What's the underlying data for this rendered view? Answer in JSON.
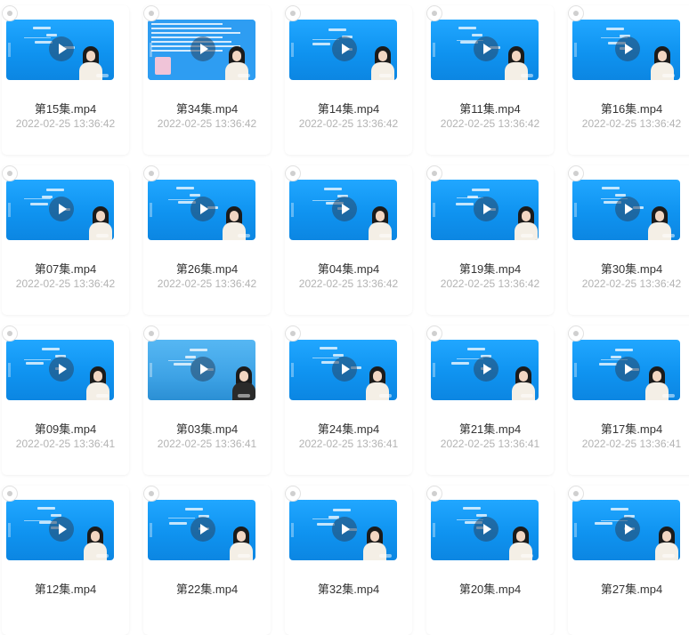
{
  "videos": [
    {
      "name": "第15集.mp4",
      "time": "2022-02-25 13:36:42",
      "variant": "normal"
    },
    {
      "name": "第34集.mp4",
      "time": "2022-02-25 13:36:42",
      "variant": "doc"
    },
    {
      "name": "第14集.mp4",
      "time": "2022-02-25 13:36:42",
      "variant": "normal"
    },
    {
      "name": "第11集.mp4",
      "time": "2022-02-25 13:36:42",
      "variant": "normal"
    },
    {
      "name": "第16集.mp4",
      "time": "2022-02-25 13:36:42",
      "variant": "normal"
    },
    {
      "name": "第07集.mp4",
      "time": "2022-02-25 13:36:42",
      "variant": "normal"
    },
    {
      "name": "第26集.mp4",
      "time": "2022-02-25 13:36:42",
      "variant": "normal"
    },
    {
      "name": "第04集.mp4",
      "time": "2022-02-25 13:36:42",
      "variant": "normal"
    },
    {
      "name": "第19集.mp4",
      "time": "2022-02-25 13:36:42",
      "variant": "normal"
    },
    {
      "name": "第30集.mp4",
      "time": "2022-02-25 13:36:42",
      "variant": "normal"
    },
    {
      "name": "第09集.mp4",
      "time": "2022-02-25 13:36:41",
      "variant": "normal"
    },
    {
      "name": "第03集.mp4",
      "time": "2022-02-25 13:36:41",
      "variant": "alt"
    },
    {
      "name": "第24集.mp4",
      "time": "2022-02-25 13:36:41",
      "variant": "normal"
    },
    {
      "name": "第21集.mp4",
      "time": "2022-02-25 13:36:41",
      "variant": "normal"
    },
    {
      "name": "第17集.mp4",
      "time": "2022-02-25 13:36:41",
      "variant": "normal"
    },
    {
      "name": "第12集.mp4",
      "time": "",
      "variant": "normal"
    },
    {
      "name": "第22集.mp4",
      "time": "",
      "variant": "normal"
    },
    {
      "name": "第32集.mp4",
      "time": "",
      "variant": "normal"
    },
    {
      "name": "第20集.mp4",
      "time": "",
      "variant": "normal"
    },
    {
      "name": "第27集.mp4",
      "time": "",
      "variant": "normal"
    }
  ]
}
